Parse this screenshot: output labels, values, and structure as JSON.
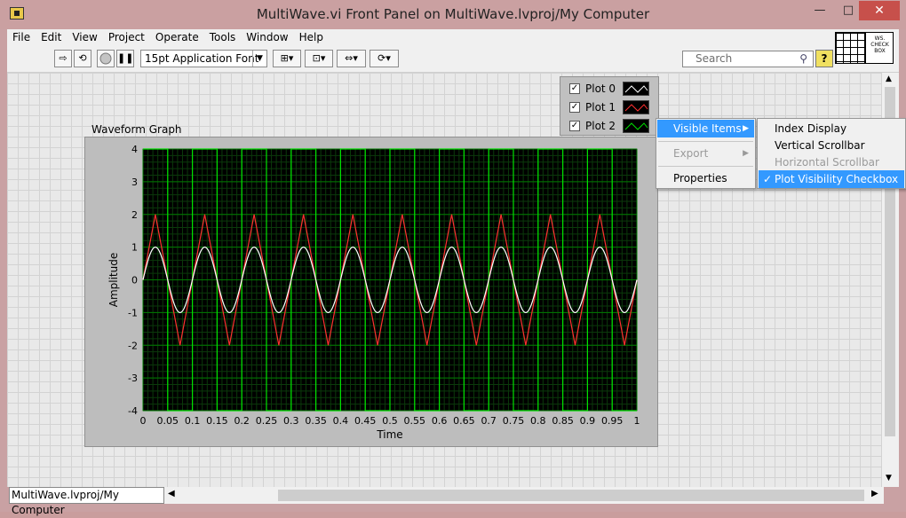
{
  "window": {
    "title": "MultiWave.vi Front Panel on MultiWave.lvproj/My Computer",
    "minimize": "—",
    "maximize": "□",
    "close": "✕"
  },
  "menu": [
    "File",
    "Edit",
    "View",
    "Project",
    "Operate",
    "Tools",
    "Window",
    "Help"
  ],
  "toolbar": {
    "font_select": "15pt Application Font",
    "search_placeholder": "Search",
    "help_label": "?",
    "connector_label": "WS. CHECK BOX"
  },
  "legend": {
    "items": [
      {
        "name": "Plot 0",
        "checked": true,
        "color": "#ffffff"
      },
      {
        "name": "Plot 1",
        "checked": true,
        "color": "#ff3030"
      },
      {
        "name": "Plot 2",
        "checked": true,
        "color": "#00e000"
      }
    ]
  },
  "graph": {
    "label": "Waveform Graph"
  },
  "context_menu": {
    "items": [
      {
        "label": "Visible Items",
        "state": "highlighted",
        "submenu": true
      },
      {
        "label": "Export",
        "state": "disabled",
        "submenu": true
      },
      {
        "label": "Properties",
        "state": "normal",
        "submenu": false
      }
    ]
  },
  "submenu": {
    "items": [
      {
        "label": "Index Display",
        "state": "normal",
        "checked": false
      },
      {
        "label": "Vertical Scrollbar",
        "state": "normal",
        "checked": false
      },
      {
        "label": "Horizontal Scrollbar",
        "state": "disabled",
        "checked": false
      },
      {
        "label": "Plot Visibility Checkbox",
        "state": "highlighted",
        "checked": true
      }
    ]
  },
  "status_bar": {
    "project_path": "MultiWave.lvproj/My Computer"
  },
  "chart_data": {
    "type": "line",
    "xlabel": "Time",
    "ylabel": "Amplitude",
    "xlim": [
      0,
      1
    ],
    "ylim": [
      -4,
      4
    ],
    "xticks": [
      "0",
      "0.05",
      "0.1",
      "0.15",
      "0.2",
      "0.25",
      "0.3",
      "0.35",
      "0.4",
      "0.45",
      "0.5",
      "0.55",
      "0.6",
      "0.65",
      "0.7",
      "0.75",
      "0.8",
      "0.85",
      "0.9",
      "0.95",
      "1"
    ],
    "yticks": [
      "4",
      "3",
      "2",
      "1",
      "0",
      "-1",
      "-2",
      "-3",
      "-4"
    ],
    "grid": true,
    "background": "#000000",
    "grid_color": "#00a000",
    "frequency": 10,
    "series": [
      {
        "name": "Plot 0",
        "shape": "sine",
        "amplitude": 1,
        "color": "#ffffff"
      },
      {
        "name": "Plot 1",
        "shape": "triangle",
        "amplitude": 2,
        "color": "#ff3030"
      },
      {
        "name": "Plot 2",
        "shape": "square",
        "amplitude": 4,
        "color": "#00e000"
      }
    ]
  }
}
